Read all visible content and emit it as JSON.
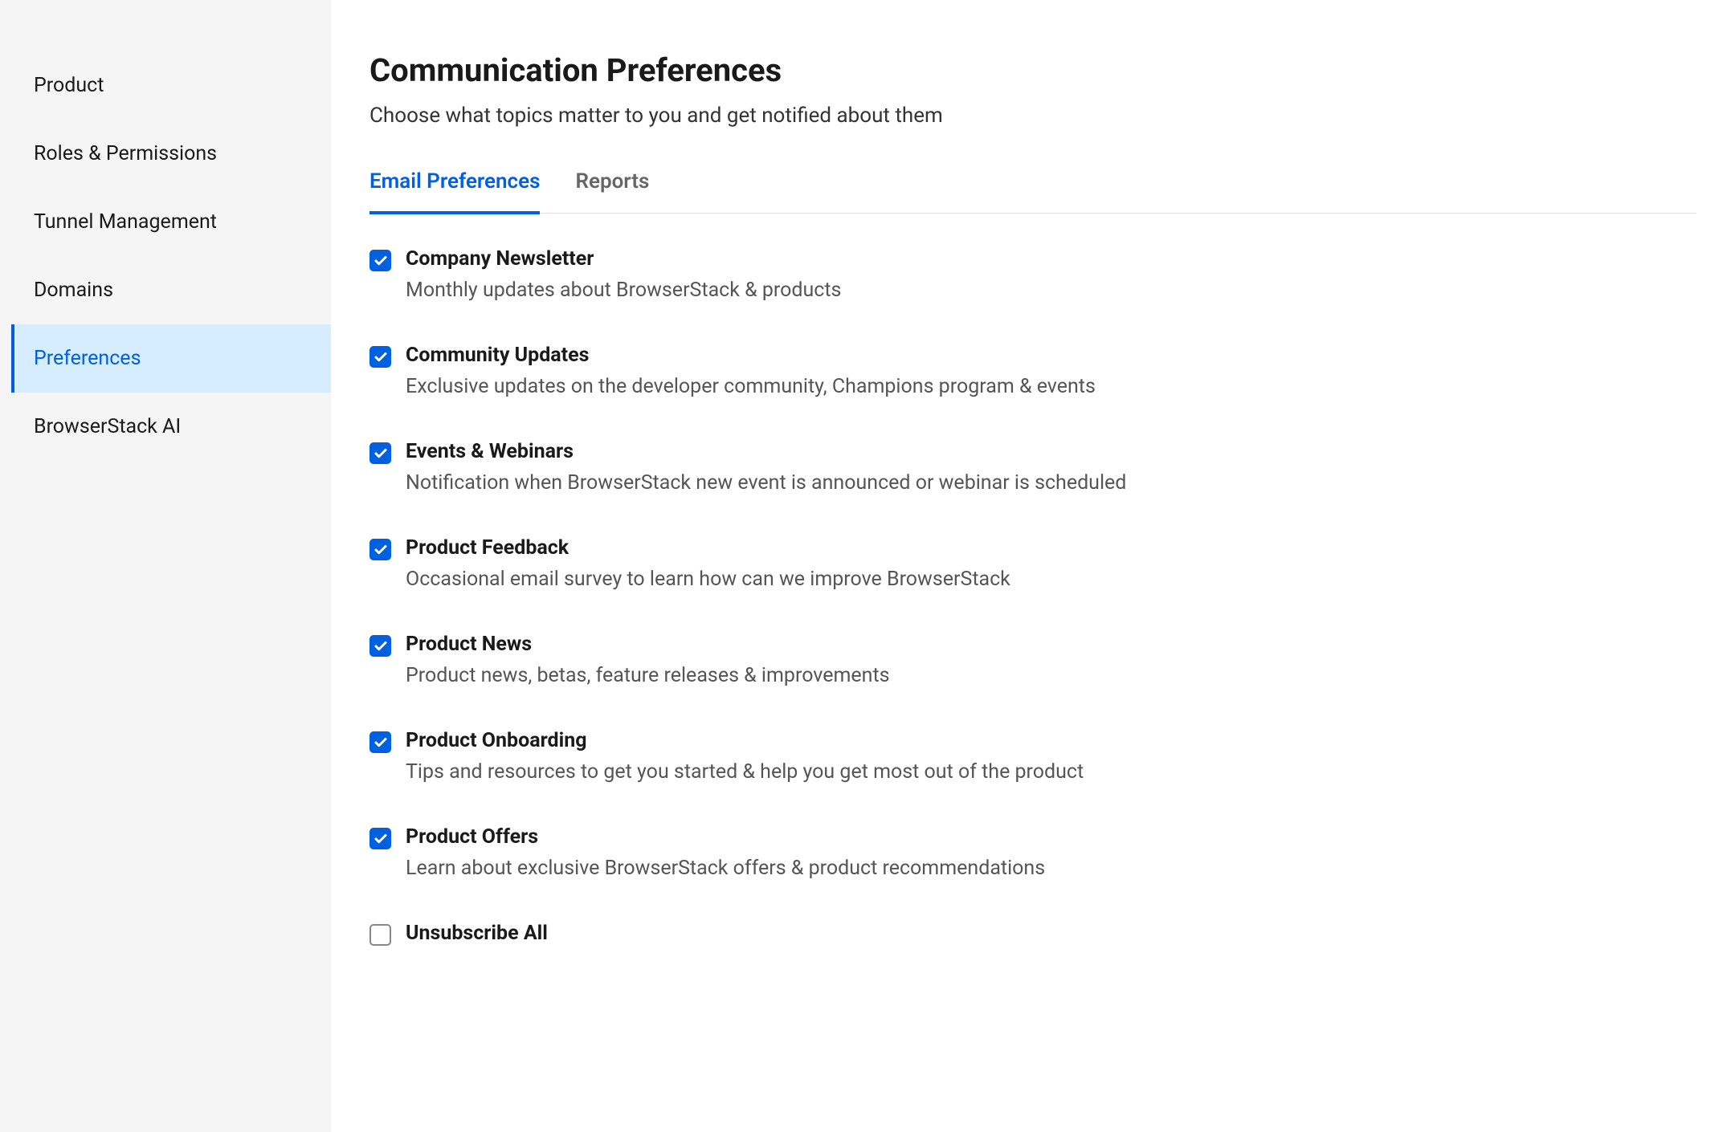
{
  "sidebar": {
    "items": [
      {
        "label": "Product",
        "active": false
      },
      {
        "label": "Roles & Permissions",
        "active": false
      },
      {
        "label": "Tunnel Management",
        "active": false
      },
      {
        "label": "Domains",
        "active": false
      },
      {
        "label": "Preferences",
        "active": true
      },
      {
        "label": "BrowserStack AI",
        "active": false
      }
    ]
  },
  "header": {
    "title": "Communication Preferences",
    "subtitle": "Choose what topics matter to you and get notified about them"
  },
  "tabs": [
    {
      "label": "Email Preferences",
      "active": true
    },
    {
      "label": "Reports",
      "active": false
    }
  ],
  "preferences": [
    {
      "title": "Company Newsletter",
      "description": "Monthly updates about BrowserStack & products",
      "checked": true
    },
    {
      "title": "Community Updates",
      "description": "Exclusive updates on the developer community, Champions program & events",
      "checked": true
    },
    {
      "title": "Events & Webinars",
      "description": "Notification when BrowserStack new event is announced or webinar is scheduled",
      "checked": true
    },
    {
      "title": "Product Feedback",
      "description": "Occasional email survey to learn how can we improve BrowserStack",
      "checked": true
    },
    {
      "title": "Product News",
      "description": "Product news, betas, feature releases & improvements",
      "checked": true
    },
    {
      "title": "Product Onboarding",
      "description": "Tips and resources to get you started & help you get most out of the product",
      "checked": true
    },
    {
      "title": "Product Offers",
      "description": "Learn about exclusive BrowserStack offers & product recommendations",
      "checked": true
    },
    {
      "title": "Unsubscribe All",
      "description": "",
      "checked": false
    }
  ]
}
